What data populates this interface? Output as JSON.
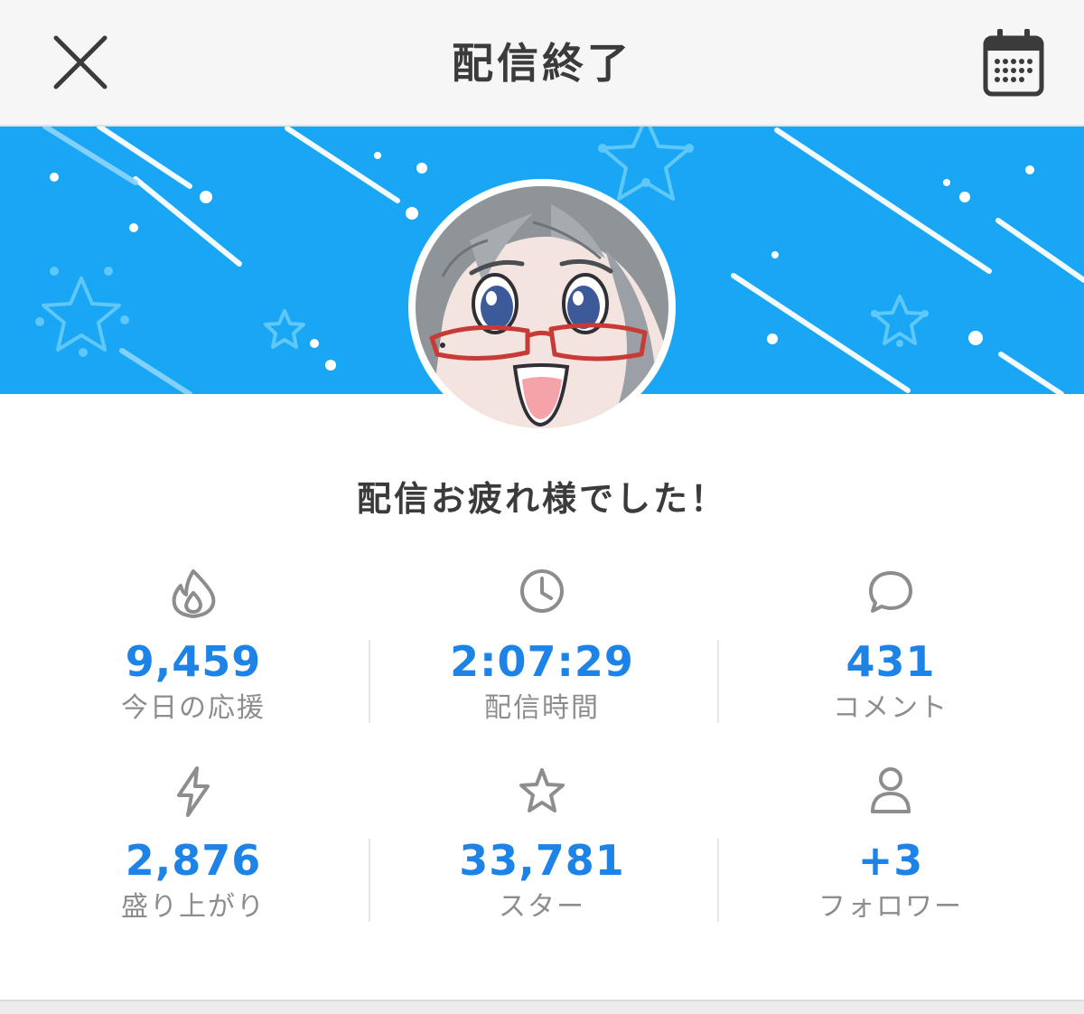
{
  "header": {
    "title": "配信終了",
    "close_icon": "close-icon",
    "calendar_icon": "calendar-icon"
  },
  "banner": {
    "background_color": "#19a7f5",
    "decoration": [
      "shooting-star-lines",
      "star-outline-icons",
      "dots"
    ]
  },
  "main": {
    "greeting": "配信お疲れ様でした！",
    "stats": [
      {
        "icon": "flame-icon",
        "value": "9,459",
        "label": "今日の応援"
      },
      {
        "icon": "clock-icon",
        "value": "2:07:29",
        "label": "配信時間"
      },
      {
        "icon": "speech-bubble-icon",
        "value": "431",
        "label": "コメント"
      },
      {
        "icon": "lightning-icon",
        "value": "2,876",
        "label": "盛り上がり"
      },
      {
        "icon": "star-icon",
        "value": "33,781",
        "label": "スター"
      },
      {
        "icon": "person-icon",
        "value": "+3",
        "label": "フォロワー"
      }
    ]
  },
  "colors": {
    "accent": "#1d83e6",
    "label": "#8d8d8d",
    "title": "#3b3b3b",
    "header_bg": "#f6f6f6"
  }
}
